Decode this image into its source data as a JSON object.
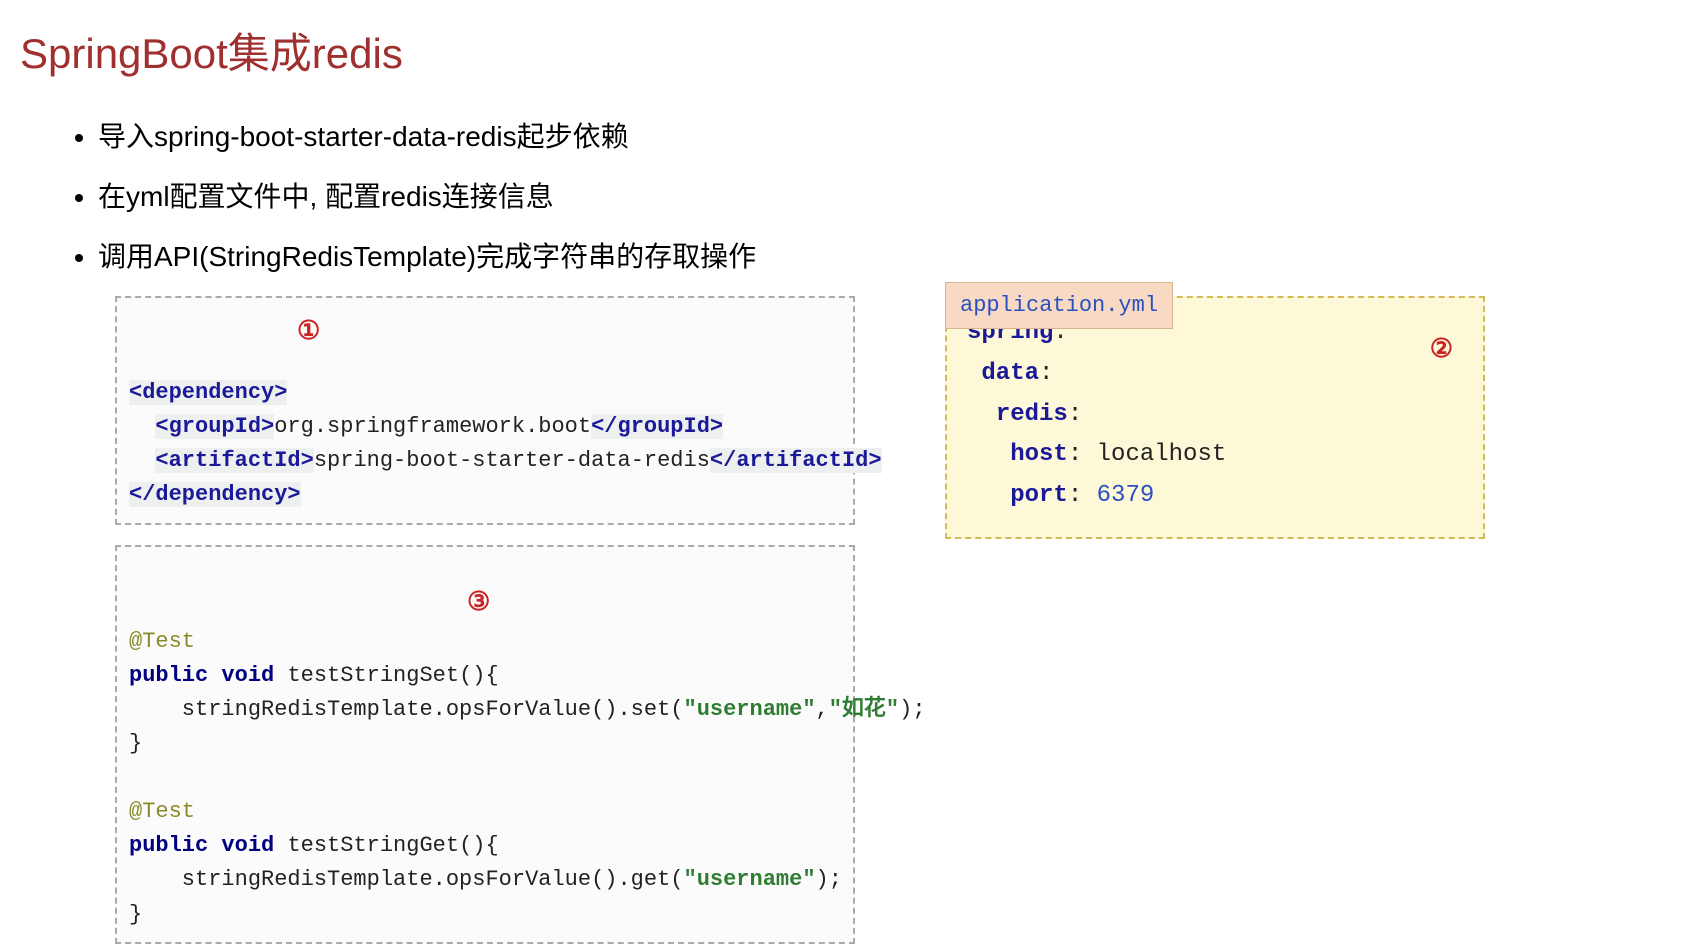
{
  "title": "SpringBoot集成redis",
  "bullets": [
    "导入spring-boot-starter-data-redis起步依赖",
    "在yml配置文件中, 配置redis连接信息",
    "调用API(StringRedisTemplate)完成字符串的存取操作"
  ],
  "circled": {
    "one": "①",
    "two": "②",
    "three": "③"
  },
  "dep": {
    "open": "<dependency>",
    "groupId_open": "<groupId>",
    "groupId_val": "org.springframework.boot",
    "groupId_close": "</groupId>",
    "artifactId_open": "<artifactId>",
    "artifactId_val": "spring-boot-starter-data-redis",
    "artifactId_close": "</artifactId>",
    "close": "</dependency>"
  },
  "test": {
    "annot": "@Test",
    "sig_set": "public void testStringSet(){",
    "set_prefix": "    stringRedisTemplate.opsForValue().set(",
    "set_arg1": "\"username\"",
    "set_comma": ",",
    "set_arg2": "\"如花\"",
    "set_suffix": ");",
    "brace_close": "}",
    "sig_get": "public void testStringGet(){",
    "get_prefix": "    stringRedisTemplate.opsForValue().get(",
    "get_arg1": "\"username\"",
    "get_suffix": ");"
  },
  "yml": {
    "filename": "application.yml",
    "spring": "spring",
    "data": "data",
    "redis": "redis",
    "host_k": "host",
    "host_v": "localhost",
    "port_k": "port",
    "port_v": "6379",
    "colon": ":"
  }
}
